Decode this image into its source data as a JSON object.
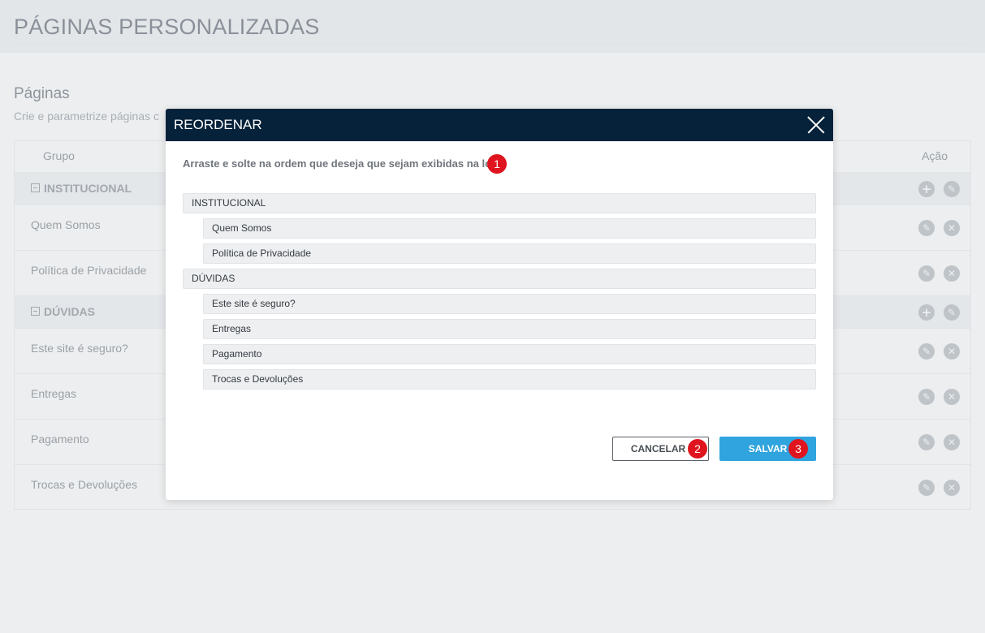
{
  "page": {
    "title": "PÁGINAS PERSONALIZADAS",
    "section_title": "Páginas",
    "section_subtitle": "Crie e parametrize páginas c"
  },
  "table": {
    "col_group": "Grupo",
    "col_action": "Ação",
    "rows": [
      {
        "type": "group",
        "label": "INSTITUCIONAL"
      },
      {
        "type": "item",
        "label": "Quem Somos"
      },
      {
        "type": "item",
        "label": "Política de Privacidade"
      },
      {
        "type": "group",
        "label": "DÚVIDAS"
      },
      {
        "type": "item",
        "label": "Este site é seguro?"
      },
      {
        "type": "item",
        "label": "Entregas"
      },
      {
        "type": "item",
        "label": "Pagamento"
      },
      {
        "type": "item",
        "label": "Trocas e Devoluções"
      }
    ]
  },
  "modal": {
    "title": "REORDENAR",
    "instruction": "Arraste e solte na ordem que deseja que sejam exibidas na loja.",
    "badge_instruction": "1",
    "items": [
      {
        "label": "INSTITUCIONAL",
        "level": 0
      },
      {
        "label": "Quem Somos",
        "level": 1
      },
      {
        "label": "Política de Privacidade",
        "level": 1
      },
      {
        "label": "DÚVIDAS",
        "level": 0
      },
      {
        "label": "Este site é seguro?",
        "level": 1
      },
      {
        "label": "Entregas",
        "level": 1
      },
      {
        "label": "Pagamento",
        "level": 1
      },
      {
        "label": "Trocas e Devoluções",
        "level": 1
      }
    ],
    "cancel_label": "CANCELAR",
    "badge_cancel": "2",
    "save_label": "SALVAR",
    "badge_save": "3"
  },
  "colors": {
    "modal_header": "#06223a",
    "save_button": "#2fa4de",
    "badge": "#e0141e"
  },
  "icons": {
    "add": "plus-circle-icon",
    "edit": "edit-icon",
    "delete": "close-circle-icon",
    "collapse": "minus-square-icon",
    "modal_close": "close-icon"
  }
}
